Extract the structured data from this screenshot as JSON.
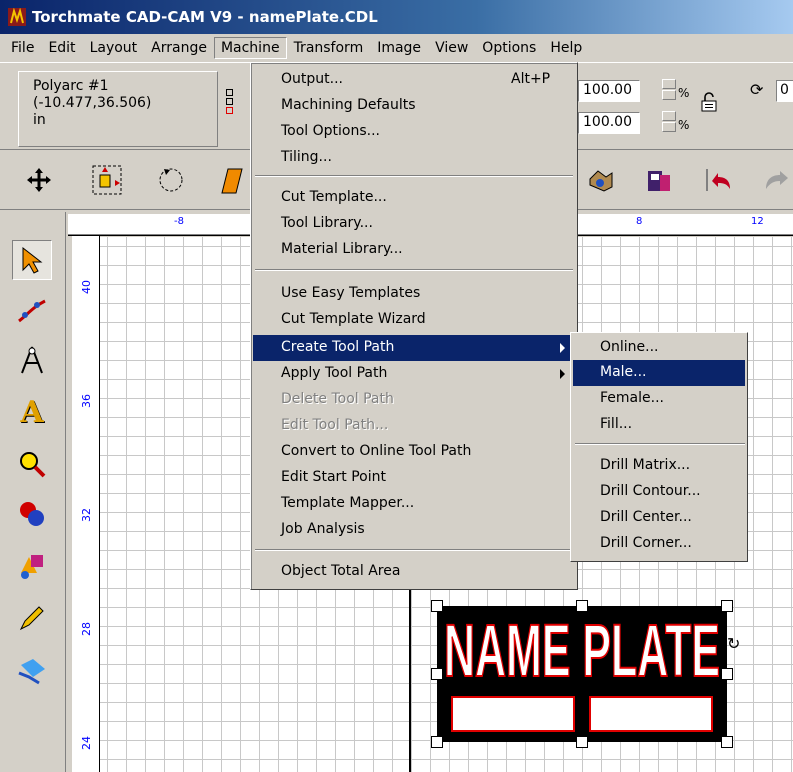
{
  "window": {
    "title": "Torchmate CAD-CAM V9 - namePlate.CDL"
  },
  "menubar": [
    "File",
    "Edit",
    "Layout",
    "Arrange",
    "Machine",
    "Transform",
    "Image",
    "View",
    "Options",
    "Help"
  ],
  "selection": {
    "name": "Polyarc #1",
    "coords": "(-10.477,36.506)",
    "units": "in"
  },
  "scale": {
    "x": "100.00",
    "y": "100.00",
    "pct": "%"
  },
  "rotate": {
    "value": "0"
  },
  "ruler": {
    "h_labels": [
      "-8",
      "8",
      "12"
    ],
    "v_labels": [
      "40",
      "36",
      "32",
      "28",
      "24"
    ]
  },
  "machine_menu": {
    "items": [
      {
        "label": "Output...",
        "accel": "Alt+P"
      },
      {
        "label": "Machining Defaults"
      },
      {
        "label": "Tool Options..."
      },
      {
        "label": "Tiling..."
      },
      {
        "label": "Cut Template..."
      },
      {
        "label": "Tool Library..."
      },
      {
        "label": "Material Library..."
      },
      {
        "label": "Use Easy Templates"
      },
      {
        "label": "Cut Template Wizard"
      },
      {
        "label": "Create Tool Path"
      },
      {
        "label": "Apply Tool Path"
      },
      {
        "label": "Delete Tool Path"
      },
      {
        "label": "Edit Tool Path..."
      },
      {
        "label": "Convert to Online Tool Path"
      },
      {
        "label": "Edit Start Point"
      },
      {
        "label": "Template Mapper..."
      },
      {
        "label": "Job Analysis"
      },
      {
        "label": "Object Total Area"
      }
    ]
  },
  "create_tool_path_submenu": {
    "items": [
      "Online...",
      "Male...",
      "Female...",
      "Fill...",
      "Drill Matrix...",
      "Drill Contour...",
      "Drill Center...",
      "Drill Corner..."
    ]
  },
  "canvas": {
    "nameplate_text": "NAME PLATE"
  },
  "colors": {
    "highlight": "#0a246a",
    "accent_red": "#e00000",
    "ruler_text": "#0000ff"
  }
}
